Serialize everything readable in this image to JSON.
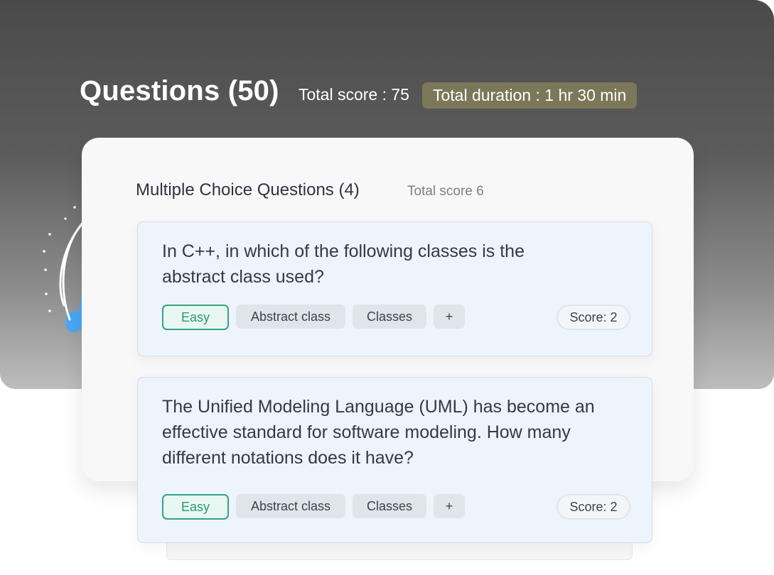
{
  "header": {
    "title": "Questions (50)",
    "total_score": "Total score : 75",
    "total_duration": "Total duration : 1 hr 30 min"
  },
  "section": {
    "title": "Multiple Choice Questions (4)",
    "score": "Total score 6"
  },
  "questions": [
    {
      "text": "In C++, in which of the following classes is the abstract class used?",
      "difficulty": "Easy",
      "tags": [
        "Abstract class",
        "Classes"
      ],
      "add_tag": "+",
      "score": "Score: 2"
    },
    {
      "text": "The Unified Modeling Language (UML) has become an effective standard for software modeling. How many different notations does it have?",
      "difficulty": "Easy",
      "tags": [
        "Abstract class",
        "Classes"
      ],
      "add_tag": "+",
      "score": "Score: 2"
    }
  ],
  "colors": {
    "easy_accent": "#36a37e",
    "duration_badge": "#7a7858",
    "card_background": "#edf4fc",
    "decoration_blue": "#4aa7f3"
  }
}
